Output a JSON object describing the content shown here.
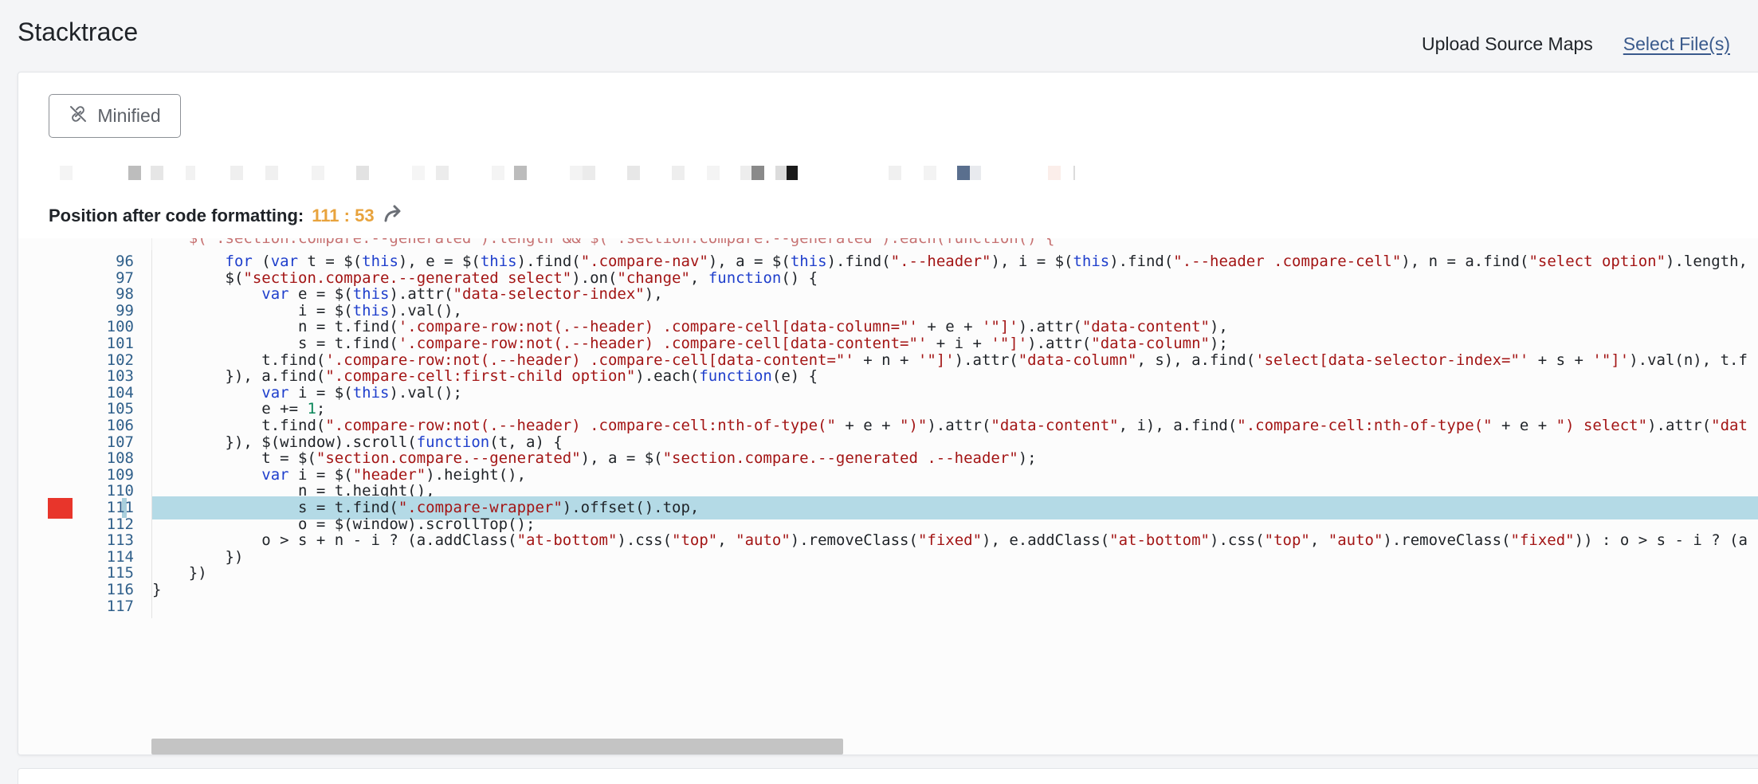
{
  "header": {
    "title": "Stacktrace",
    "upload_label": "Upload Source Maps",
    "select_files_label": "Select File(s)"
  },
  "toolbar": {
    "minified_label": "Minified",
    "minified_icon": "link-off-icon"
  },
  "position": {
    "label": "Position after code formatting:",
    "value": "111 : 53",
    "icon": "redirect-arrow-icon"
  },
  "colors": {
    "accent_orange": "#e8a33d",
    "breakpoint_red": "#e8352b",
    "highlight_blue": "#b4dae6",
    "link_blue": "#3a5a8c"
  },
  "code": {
    "highlighted_line": 111,
    "lines": [
      {
        "n": "96",
        "html": "        <span class=\"kw\">for</span> (<span class=\"kw\">var</span> t = $(<span class=\"kw\">this</span>), e = $(<span class=\"kw\">this</span>).find(<span class=\"str\">\".compare-nav\"</span>), a = $(<span class=\"kw\">this</span>).find(<span class=\"str\">\".--header\"</span>), i = $(<span class=\"kw\">this</span>).find(<span class=\"str\">\".--header .compare-cell\"</span>), n = a.find(<span class=\"str\">\"select option\"</span>).length,"
      },
      {
        "n": "97",
        "html": "        $(<span class=\"str\">\"section.compare.--generated select\"</span>).on(<span class=\"str\">\"change\"</span>, <span class=\"kw\">function</span>() {"
      },
      {
        "n": "98",
        "html": "            <span class=\"kw\">var</span> e = $(<span class=\"kw\">this</span>).attr(<span class=\"str\">\"data-selector-index\"</span>),"
      },
      {
        "n": "99",
        "html": "                i = $(<span class=\"kw\">this</span>).val(),"
      },
      {
        "n": "100",
        "html": "                n = t.find(<span class=\"str\">'.compare-row:not(.--header) .compare-cell[data-column=\"'</span> + e + <span class=\"str\">'\"]'</span>).attr(<span class=\"str\">\"data-content\"</span>),"
      },
      {
        "n": "101",
        "html": "                s = t.find(<span class=\"str\">'.compare-row:not(.--header) .compare-cell[data-content=\"'</span> + i + <span class=\"str\">'\"]'</span>).attr(<span class=\"str\">\"data-column\"</span>);"
      },
      {
        "n": "102",
        "html": "            t.find(<span class=\"str\">'.compare-row:not(.--header) .compare-cell[data-content=\"'</span> + n + <span class=\"str\">'\"]'</span>).attr(<span class=\"str\">\"data-column\"</span>, s), a.find(<span class=\"str\">'select[data-selector-index=\"'</span> + s + <span class=\"str\">'\"]'</span>).val(n), t.f"
      },
      {
        "n": "103",
        "html": "        }), a.find(<span class=\"str\">\".compare-cell:first-child option\"</span>).each(<span class=\"kw\">function</span>(e) {"
      },
      {
        "n": "104",
        "html": "            <span class=\"kw\">var</span> i = $(<span class=\"kw\">this</span>).val();"
      },
      {
        "n": "105",
        "html": "            e += <span class=\"num\">1</span>;"
      },
      {
        "n": "106",
        "html": "            t.find(<span class=\"str\">\".compare-row:not(.--header) .compare-cell:nth-of-type(\"</span> + e + <span class=\"str\">\")\"</span>).attr(<span class=\"str\">\"data-content\"</span>, i), a.find(<span class=\"str\">\".compare-cell:nth-of-type(\"</span> + e + <span class=\"str\">\") select\"</span>).attr(<span class=\"str\">\"dat</span>"
      },
      {
        "n": "107",
        "html": "        }), $(window).scroll(<span class=\"kw\">function</span>(t, a) {"
      },
      {
        "n": "108",
        "html": "            t = $(<span class=\"str\">\"section.compare.--generated\"</span>), a = $(<span class=\"str\">\"section.compare.--generated .--header\"</span>);"
      },
      {
        "n": "109",
        "html": "            <span class=\"kw\">var</span> i = $(<span class=\"str\">\"header\"</span>).height(),"
      },
      {
        "n": "110",
        "html": "                n = t.height(),"
      },
      {
        "n": "111",
        "html": "                s = t.find(<span class=\"str\">\".compare-wrapper\"</span>).offset().top,"
      },
      {
        "n": "112",
        "html": "                o = $(window).scrollTop();"
      },
      {
        "n": "113",
        "html": "            o &gt; s + n - i ? (a.addClass(<span class=\"str\">\"at-bottom\"</span>).css(<span class=\"str\">\"top\"</span>, <span class=\"str\">\"auto\"</span>).removeClass(<span class=\"str\">\"fixed\"</span>), e.addClass(<span class=\"str\">\"at-bottom\"</span>).css(<span class=\"str\">\"top\"</span>, <span class=\"str\">\"auto\"</span>).removeClass(<span class=\"str\">\"fixed\"</span>)) : o &gt; s - i ? (a"
      },
      {
        "n": "114",
        "html": "        })"
      },
      {
        "n": "115",
        "html": "    })"
      },
      {
        "n": "116",
        "html": "}"
      },
      {
        "n": "117",
        "html": ""
      }
    ]
  }
}
